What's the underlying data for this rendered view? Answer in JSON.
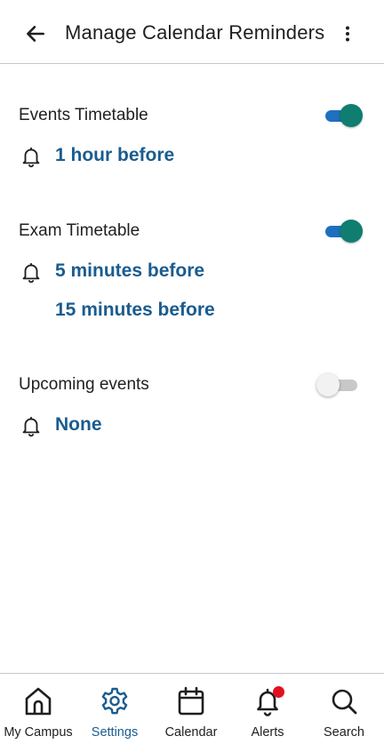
{
  "appbar": {
    "title": "Manage Calendar Reminders",
    "back_icon": "arrow-left-icon",
    "menu_icon": "more-vert-icon"
  },
  "sections": [
    {
      "title": "Events Timetable",
      "enabled": true,
      "reminders": [
        "1 hour before"
      ]
    },
    {
      "title": "Exam Timetable",
      "enabled": true,
      "reminders": [
        "5 minutes before",
        "15 minutes before"
      ]
    },
    {
      "title": "Upcoming events",
      "enabled": false,
      "reminders": [
        "None"
      ]
    }
  ],
  "bottom_nav": {
    "items": [
      {
        "label": "My Campus",
        "icon": "home-icon",
        "active": false
      },
      {
        "label": "Settings",
        "icon": "gear-icon",
        "active": true
      },
      {
        "label": "Calendar",
        "icon": "calendar-icon",
        "active": false
      },
      {
        "label": "Alerts",
        "icon": "bell-icon",
        "active": false,
        "has_badge": true
      },
      {
        "label": "Search",
        "icon": "search-icon",
        "active": false
      }
    ]
  },
  "colors": {
    "accent_text": "#1a5c8f",
    "toggle_track_on": "#1f6fbf",
    "toggle_thumb_on": "#0f7d70",
    "badge": "#e0121e"
  }
}
